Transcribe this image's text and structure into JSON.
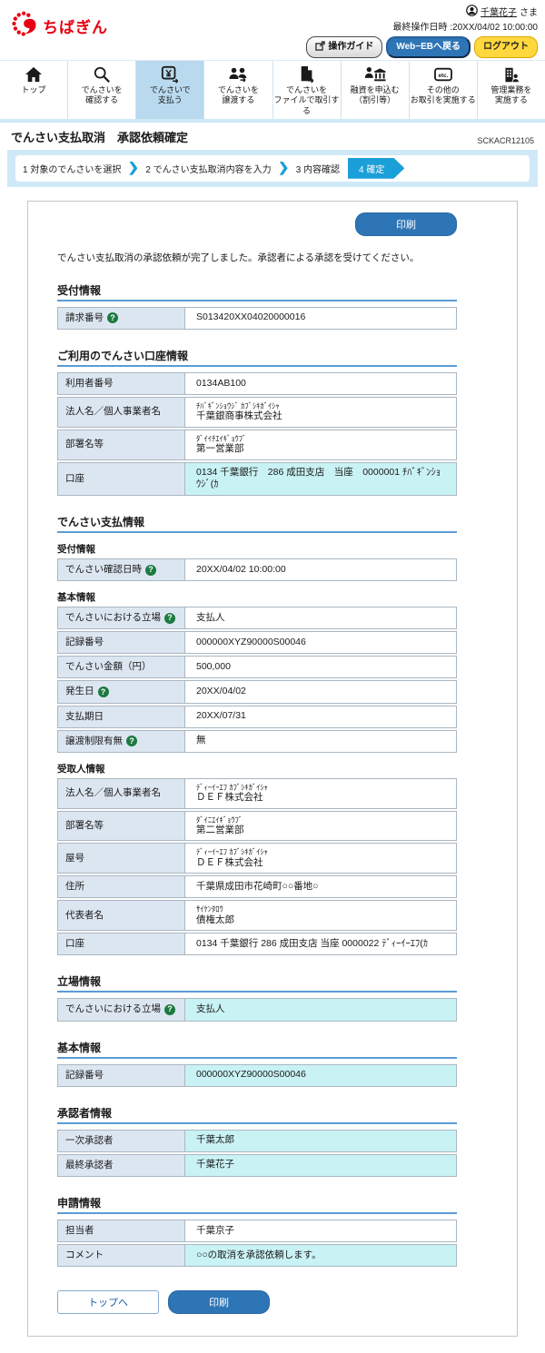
{
  "colors": {
    "brand_red": "#e60012",
    "accent_blue": "#1b9fd8",
    "button_blue": "#2e75b6",
    "highlight_cyan": "#c9f2f4",
    "logout_yellow": "#ffd83d",
    "label_bg": "#dce6f1"
  },
  "header": {
    "logo_text": "ちばぎん",
    "user_name": "千葉花子",
    "user_suffix": "さま",
    "last_operation": "最終操作日時 :20XX/04/02 10:00:00",
    "buttons": {
      "guide": "操作ガイド",
      "web_eb": "Web−EBへ戻る",
      "logout": "ログアウト"
    }
  },
  "nav": {
    "items": [
      {
        "id": "top",
        "icon": "home-icon",
        "lines": [
          "トップ"
        ],
        "active": false
      },
      {
        "id": "confirm",
        "icon": "search-icon",
        "lines": [
          "でんさいを",
          "確認する"
        ],
        "active": false
      },
      {
        "id": "pay",
        "icon": "pay-yen-icon",
        "lines": [
          "でんさいで",
          "支払う"
        ],
        "active": true
      },
      {
        "id": "transfer",
        "icon": "people-transfer-icon",
        "lines": [
          "でんさいを",
          "譲渡する"
        ],
        "active": false
      },
      {
        "id": "file",
        "icon": "file-export-icon",
        "lines": [
          "でんさいを",
          "ファイルで取引する"
        ],
        "active": false
      },
      {
        "id": "loan",
        "icon": "loan-bank-icon",
        "lines": [
          "融資を申込む",
          "（割引等）"
        ],
        "active": false
      },
      {
        "id": "other",
        "icon": "etc-icon",
        "lines": [
          "その他の",
          "お取引を実施する"
        ],
        "active": false
      },
      {
        "id": "admin",
        "icon": "building-person-icon",
        "lines": [
          "管理業務を",
          "実施する"
        ],
        "active": false
      }
    ]
  },
  "page": {
    "title": "でんさい支払取消　承認依頼確定",
    "code": "SCKACR12105",
    "steps": [
      {
        "label": "1 対象のでんさいを選択",
        "active": false
      },
      {
        "label": "2 でんさい支払取消内容を入力",
        "active": false
      },
      {
        "label": "3 内容確認",
        "active": false
      },
      {
        "label": "4 確定",
        "active": true
      }
    ],
    "message": "でんさい支払取消の承認依頼が完了しました。承認者による承認を受けてください。",
    "print_label": "印刷",
    "top_label": "トップへ"
  },
  "sections": [
    {
      "title": "受付情報",
      "groups": [
        {
          "rows": [
            {
              "label": "請求番号",
              "help": true,
              "lines": [
                "S013420XX04020000016"
              ],
              "highlight": false
            }
          ]
        }
      ]
    },
    {
      "title": "ご利用のでんさい口座情報",
      "groups": [
        {
          "rows": [
            {
              "label": "利用者番号",
              "help": false,
              "lines": [
                "0134AB100"
              ],
              "highlight": false
            },
            {
              "label": "法人名／個人事業者名",
              "help": false,
              "lines": [
                "ﾁﾊﾞｷﾞﾝｼｮｳｼﾞ ｶﾌﾞｼｷｶﾞｲｼｬ",
                "千葉銀商事株式会社"
              ],
              "highlight": false
            },
            {
              "label": "部署名等",
              "help": false,
              "lines": [
                "ﾀﾞｲｲﾁｴｲｷﾞｮｳﾌﾞ",
                "第一営業部"
              ],
              "highlight": false
            },
            {
              "label": "口座",
              "help": false,
              "lines": [
                "0134 千葉銀行　286 成田支店　当座　0000001 ﾁﾊﾞｷﾞﾝｼｮｳｼﾞ(ｶ"
              ],
              "highlight": true
            }
          ]
        }
      ]
    },
    {
      "title": "でんさい支払情報",
      "groups": [
        {
          "subtitle": "受付情報",
          "rows": [
            {
              "label": "でんさい確認日時",
              "help": true,
              "lines": [
                "20XX/04/02 10:00:00"
              ],
              "highlight": false
            }
          ]
        },
        {
          "subtitle": "基本情報",
          "rows": [
            {
              "label": "でんさいにおける立場",
              "help": true,
              "lines": [
                "支払人"
              ],
              "highlight": false
            },
            {
              "label": "記録番号",
              "help": false,
              "lines": [
                "000000XYZ90000S00046"
              ],
              "highlight": false
            },
            {
              "label": "でんさい金額（円）",
              "help": false,
              "lines": [
                "500,000"
              ],
              "highlight": false
            },
            {
              "label": "発生日",
              "help": true,
              "lines": [
                "20XX/04/02"
              ],
              "highlight": false
            },
            {
              "label": "支払期日",
              "help": false,
              "lines": [
                "20XX/07/31"
              ],
              "highlight": false
            },
            {
              "label": "譲渡制限有無",
              "help": true,
              "lines": [
                "無"
              ],
              "highlight": false
            }
          ]
        },
        {
          "subtitle": "受取人情報",
          "rows": [
            {
              "label": "法人名／個人事業者名",
              "help": false,
              "lines": [
                "ﾃﾞｨｰｲｰｴﾌ ｶﾌﾞｼｷｶﾞｲｼｬ",
                "ＤＥＦ株式会社"
              ],
              "highlight": false
            },
            {
              "label": "部署名等",
              "help": false,
              "lines": [
                "ﾀﾞｲﾆｴｲｷﾞｮｳﾌﾞ",
                "第二営業部"
              ],
              "highlight": false
            },
            {
              "label": "屋号",
              "help": false,
              "lines": [
                "ﾃﾞｨｰｲｰｴﾌ ｶﾌﾞｼｷｶﾞｲｼｬ",
                "ＤＥＦ株式会社"
              ],
              "highlight": false
            },
            {
              "label": "住所",
              "help": false,
              "lines": [
                "千葉県成田市花崎町○○番地○"
              ],
              "highlight": false
            },
            {
              "label": "代表者名",
              "help": false,
              "lines": [
                "ｻｲｹﾝﾀﾛｳ",
                "債権太郎"
              ],
              "highlight": false
            },
            {
              "label": "口座",
              "help": false,
              "lines": [
                "0134 千葉銀行 286 成田支店 当座 0000022 ﾃﾞｨｰｲｰｴﾌ(ｶ"
              ],
              "highlight": false
            }
          ]
        }
      ]
    },
    {
      "title": "立場情報",
      "groups": [
        {
          "rows": [
            {
              "label": "でんさいにおける立場",
              "help": true,
              "lines": [
                "支払人"
              ],
              "highlight": true
            }
          ]
        }
      ]
    },
    {
      "title": "基本情報",
      "groups": [
        {
          "rows": [
            {
              "label": "記録番号",
              "help": false,
              "lines": [
                "000000XYZ90000S00046"
              ],
              "highlight": true
            }
          ]
        }
      ]
    },
    {
      "title": "承認者情報",
      "groups": [
        {
          "rows": [
            {
              "label": "一次承認者",
              "help": false,
              "lines": [
                "千葉太郎"
              ],
              "highlight": true
            },
            {
              "label": "最終承認者",
              "help": false,
              "lines": [
                "千葉花子"
              ],
              "highlight": true
            }
          ]
        }
      ]
    },
    {
      "title": "申請情報",
      "groups": [
        {
          "rows": [
            {
              "label": "担当者",
              "help": false,
              "lines": [
                "千葉京子"
              ],
              "highlight": false
            },
            {
              "label": "コメント",
              "help": false,
              "lines": [
                "○○の取消を承認依頼します。"
              ],
              "highlight": true
            }
          ]
        }
      ]
    }
  ]
}
